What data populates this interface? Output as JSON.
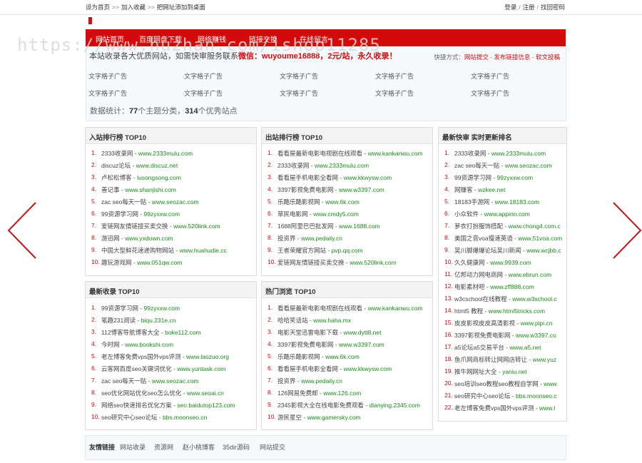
{
  "topbar": {
    "left": [
      "设为首页",
      "加入收藏",
      "把网址添加到桌面"
    ],
    "separator": ">>",
    "right": [
      "登录",
      "注册",
      "找回密码"
    ],
    "right_sep": "/"
  },
  "watermark": "https://www.huzhan.com/ishop11285",
  "nav": [
    "网站首页",
    "百度网盘下载",
    "网络赚钱",
    "链接交换",
    "在线留言"
  ],
  "notice": {
    "text": "本站收录各大优质网站，如需快审服务联系",
    "highlight": "微信：wuyoume16888，2元/站，永久收录！"
  },
  "quick": {
    "label": "快捷方式：",
    "links": [
      "网站提交",
      "发布链接信息",
      "软文投稿"
    ],
    "sep": " - "
  },
  "ads": [
    "文字格子广告",
    "文字格子广告",
    "文字格子广告",
    "文字格子广告",
    "文字格子广告",
    "文字格子广告",
    "文字格子广告",
    "文字格子广告",
    "文字格子广告",
    "文字格子广告"
  ],
  "stats": {
    "prefix": "数据统计：",
    "categories": "77",
    "mid": "个主题分类，",
    "sites": "314",
    "suffix": "个优秀站点"
  },
  "panels": {
    "in_rank": {
      "title": "入站排行榜 TOP10",
      "items": [
        {
          "n": "1.",
          "name": "2333收录网",
          "url": "www.2333mulu.com"
        },
        {
          "n": "2.",
          "name": "discuz论坛",
          "url": "www.discuz.net"
        },
        {
          "n": "3.",
          "name": "卢松松博客",
          "url": "lusongsong.com"
        },
        {
          "n": "4.",
          "name": "善记事",
          "url": "www.shanjishi.com"
        },
        {
          "n": "5.",
          "name": "zac seo每天一贴",
          "url": "www.seozac.com"
        },
        {
          "n": "6.",
          "name": "99资源学习网",
          "url": "99zyxxw.com"
        },
        {
          "n": "7.",
          "name": "爱链网友情链接买卖交换",
          "url": "www.520link.com"
        },
        {
          "n": "8.",
          "name": "游迅网",
          "url": "www.yxdown.com"
        },
        {
          "n": "9.",
          "name": "中国大型鲜花速递购物网站",
          "url": "www.huahudie.cc"
        },
        {
          "n": "10.",
          "name": "趣玩游戏网",
          "url": "www.051qw.com"
        }
      ]
    },
    "out_rank": {
      "title": "出站排行榜 TOP10",
      "items": [
        {
          "n": "1.",
          "name": "看看屋最新电影电视剧在线观看",
          "url": "www.kankanwu.com"
        },
        {
          "n": "2.",
          "name": "2333收录网",
          "url": "www.2333mulu.com"
        },
        {
          "n": "3.",
          "name": "看看屋手机电影全看网",
          "url": "www.kkwysw.com"
        },
        {
          "n": "4.",
          "name": "3397影视免费电影网",
          "url": "www.w3397.com"
        },
        {
          "n": "5.",
          "name": "乐酷乐酷影视网",
          "url": "www.6k.com"
        },
        {
          "n": "6.",
          "name": "草民电影网",
          "url": "www.cmdy5.com"
        },
        {
          "n": "7.",
          "name": "1688阿里巴巴批发网",
          "url": "www.1688.com"
        },
        {
          "n": "8.",
          "name": "投资界",
          "url": "www.pedaily.cn"
        },
        {
          "n": "9.",
          "name": "王者荣耀官方网站",
          "url": "pvp.qq.com"
        },
        {
          "n": "10.",
          "name": "爱链网友情链接买卖交换",
          "url": "www.520link.com"
        }
      ]
    },
    "latest": {
      "title": "最新快审 实时更新排名",
      "items": [
        {
          "n": "1.",
          "name": "2333收录网",
          "url": "www.2333mulu.com"
        },
        {
          "n": "2.",
          "name": "zac seo每天一贴",
          "url": "www.seozac.com"
        },
        {
          "n": "3.",
          "name": "99资源学习网",
          "url": "99zyxxw.com"
        },
        {
          "n": "4.",
          "name": "网赚客",
          "url": "wzkee.net"
        },
        {
          "n": "5.",
          "name": "18183手游网",
          "url": "www.18183.com"
        },
        {
          "n": "6.",
          "name": "小众软件",
          "url": "www.appinn.com"
        },
        {
          "n": "7.",
          "name": "萝衣打扮服饰搭配",
          "url": "www.chong4.com.c"
        },
        {
          "n": "8.",
          "name": "美国之音voa慢速英语",
          "url": "www.51voa.com"
        },
        {
          "n": "9.",
          "name": "吴川脚爆爆论坛吴川新闻",
          "url": "www.wcjbb.c"
        },
        {
          "n": "10.",
          "name": "久久健康网",
          "url": "www.9939.com"
        },
        {
          "n": "11.",
          "name": "亿邦动力网电商网",
          "url": "www.ebrun.com"
        },
        {
          "n": "12.",
          "name": "电影素材吧",
          "url": "www.zff888.com"
        },
        {
          "n": "13.",
          "name": "w3cschool在线教程",
          "url": "www.w3school.c"
        },
        {
          "n": "14.",
          "name": "html5 教程",
          "url": "www.html5tricks.com"
        },
        {
          "n": "15.",
          "name": "皮皮影视皮皮高清影视",
          "url": "www.pipi.cn"
        },
        {
          "n": "16.",
          "name": "3397影视免费电影网",
          "url": "www.w3397.co"
        },
        {
          "n": "17.",
          "name": "a5论坛a5交易平台",
          "url": "www.a5.net"
        },
        {
          "n": "18.",
          "name": "鱼爪网商标转让网网店转让",
          "url": "www.yuz"
        },
        {
          "n": "19.",
          "name": "推牛网网址大全",
          "url": "yaniu.net"
        },
        {
          "n": "20.",
          "name": "seo培训seo教程seo教程自学网",
          "url": "www"
        },
        {
          "n": "21.",
          "name": "seo研究中心seo论坛",
          "url": "bbs.moonseo.c"
        },
        {
          "n": "22.",
          "name": "老左博客免费vps国外vps评测",
          "url": "www.l"
        }
      ]
    },
    "newest": {
      "title": "最新收录 TOP10",
      "items": [
        {
          "n": "1.",
          "name": "99资源学习网",
          "url": "99zyxxw.com"
        },
        {
          "n": "2.",
          "name": "笔趣231阅读",
          "url": "biqu.231e.cn"
        },
        {
          "n": "3.",
          "name": "112博客导航博客大全",
          "url": "boke112.com"
        },
        {
          "n": "4.",
          "name": "今时网",
          "url": "www.bookshi.com"
        },
        {
          "n": "5.",
          "name": "老左博客免费vps国外vps评测",
          "url": "www.laozuo.org"
        },
        {
          "n": "6.",
          "name": "云客网百度seo关键词优化",
          "url": "www.yuntask.com"
        },
        {
          "n": "7.",
          "name": "zac seo每天一贴",
          "url": "www.seozac.com"
        },
        {
          "n": "8.",
          "name": "seo优化网站优化seo怎么优化",
          "url": "www.seoai.cn"
        },
        {
          "n": "9.",
          "name": "网络seo快速排名优化方案",
          "url": "seo.baidutop123.com"
        },
        {
          "n": "10.",
          "name": "seo研究中心seo论坛",
          "url": "bbs.moonseo.cn"
        }
      ]
    },
    "hot": {
      "title": "热门浏览 TOP10",
      "items": [
        {
          "n": "1.",
          "name": "看看屋最新电影电视剧在线观看",
          "url": "www.kankanwu.com"
        },
        {
          "n": "2.",
          "name": "哈哈笑话站",
          "url": "www.haha.mx"
        },
        {
          "n": "3.",
          "name": "电影天堂迅雷电影下载",
          "url": "www.dytt8.net"
        },
        {
          "n": "4.",
          "name": "3397影视免费电影网",
          "url": "www.w3397.com"
        },
        {
          "n": "5.",
          "name": "乐酷乐酷影视网",
          "url": "www.6k.com"
        },
        {
          "n": "6.",
          "name": "看看屋手机电影全看网",
          "url": "www.kkwysw.com"
        },
        {
          "n": "7.",
          "name": "投资界",
          "url": "www.pedaily.cn"
        },
        {
          "n": "8.",
          "name": "126网易免费邮",
          "url": "www.126.com"
        },
        {
          "n": "9.",
          "name": "2345影视大全在线电影免费观看",
          "url": "dianying.2345.com"
        },
        {
          "n": "10.",
          "name": "游民星空",
          "url": "www.gamersky.com"
        }
      ]
    }
  },
  "links": {
    "title": "友情链接",
    "items": [
      "网站收录",
      "资源网",
      "赵小桃博客",
      "35dir源码",
      "网站提交"
    ]
  },
  "colors": {
    "accent": "#d40a0a",
    "url": "#1a8a1a",
    "panel_header": "#f3f3f3"
  },
  "arrows": [
    "arrow-left-icon",
    "arrow-right-icon"
  ]
}
